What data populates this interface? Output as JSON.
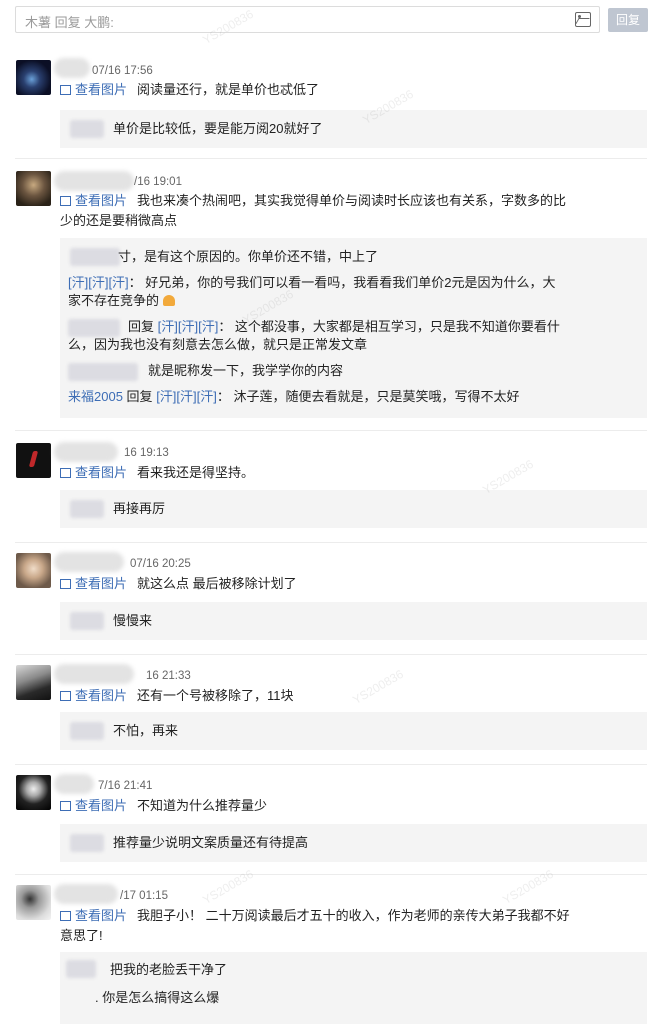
{
  "reply_bar": {
    "placeholder": "木薯 回复 大鹏:",
    "button": "回复",
    "image_icon": "image-icon"
  },
  "view_image_label": "查看图片",
  "comments": [
    {
      "time": "07/16 17:56",
      "text": "阅读量还行，就是单价也忒低了",
      "replies": [
        {
          "text": "单价是比较低，要是能万阅20就好了"
        }
      ]
    },
    {
      "time": "/16 19:01",
      "text_line1": "我也来凑个热闹吧，其实我觉得单价与阅读时长应该也有关系，字数多的比",
      "text_line2": "少的还是要稍微高点",
      "replies": [
        {
          "text": "寸，是有这个原因的。你单价还不错，中上了"
        },
        {
          "prefix": "[汗][汗][汗]",
          "line1": "：  好兄弟，你的号我们可以看一看吗，我看看我们单价2元是因为什么，大",
          "line2": "家不存在竞争的"
        },
        {
          "prefix": "回复",
          "emoji": "[汗][汗][汗]",
          "line1": "：  这个都没事，大家都是相互学习，只是我不知道你要看什",
          "line2": "么，因为我也没有刻意去怎么做，就只是正常发文章"
        },
        {
          "text": "就是昵称发一下，我学学你的内容"
        },
        {
          "name": "来福2005",
          "prefix": "回复",
          "emoji": "[汗][汗][汗]",
          "text": "：  沐子莲，随便去看就是，只是莫笑哦，写得不太好"
        }
      ]
    },
    {
      "time": "16 19:13",
      "text": "看来我还是得坚持。",
      "replies": [
        {
          "text": "再接再厉"
        }
      ]
    },
    {
      "time": "07/16 20:25",
      "text": "就这么点  最后被移除计划了",
      "replies": [
        {
          "text": "慢慢来"
        }
      ]
    },
    {
      "time": "16 21:33",
      "text": "还有一个号被移除了，11块",
      "replies": [
        {
          "text": "不怕，再来"
        }
      ]
    },
    {
      "time": "7/16 21:41",
      "text": "不知道为什么推荐量少",
      "replies": [
        {
          "text": "推荐量少说明文案质量还有待提高"
        }
      ]
    },
    {
      "time": "/17 01:15",
      "text_line1": "我胆子小！ 二十万阅读最后才五十的收入，作为老师的亲传大弟子我都不好",
      "text_line2": "意思了!",
      "replies": [
        {
          "text": "把我的老脸丢干净了"
        },
        {
          "text": ".  你是怎么搞得这么爆"
        }
      ]
    }
  ],
  "watermark_text": "YS200836"
}
